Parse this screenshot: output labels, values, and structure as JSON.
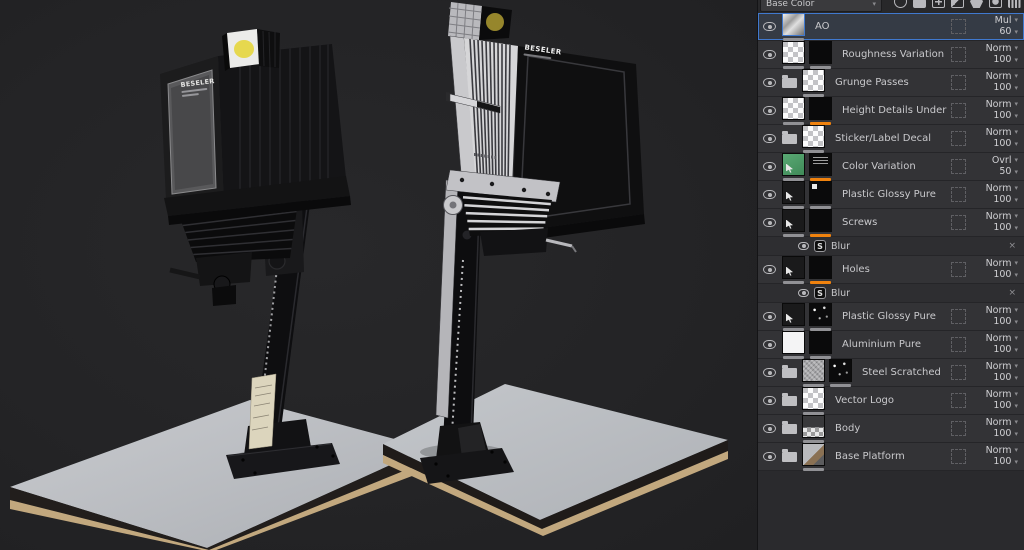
{
  "viewport": {
    "models": [
      {
        "name": "enlarger-left",
        "brand_label": "BESELER"
      },
      {
        "name": "enlarger-right",
        "brand_label": "BESELER"
      }
    ]
  },
  "layers_panel": {
    "channel_selector": {
      "value": "Base Color"
    },
    "glyphs": {
      "caret": "▾",
      "close": "×",
      "substance_effect": "S"
    },
    "colors": {
      "accent_orange": "#ef820e",
      "selection_blue": "#4079cf",
      "underline_gray": "#919195"
    },
    "toolbar": {
      "icons": [
        {
          "name": "add-effect-icon"
        },
        {
          "name": "add-folder-icon"
        },
        {
          "name": "add-layer-icon"
        },
        {
          "name": "add-fill-layer-icon"
        },
        {
          "name": "add-smart-material-icon"
        },
        {
          "name": "add-mask-icon"
        },
        {
          "name": "delete-layer-icon"
        }
      ]
    },
    "layers": [
      {
        "name": "AO",
        "blend": "Mul",
        "opacity": "60",
        "selected": true,
        "folder": false,
        "thumbs": [
          {
            "type": "ao",
            "underline": "gray"
          }
        ],
        "effects": []
      },
      {
        "name": "Roughness Variation",
        "blend": "Norm",
        "opacity": "100",
        "selected": false,
        "folder": false,
        "thumbs": [
          {
            "type": "checker",
            "underline": "gray"
          },
          {
            "type": "black",
            "underline": "gray"
          }
        ],
        "effects": []
      },
      {
        "name": "Grunge Passes",
        "blend": "Norm",
        "opacity": "100",
        "selected": false,
        "folder": true,
        "thumbs": [
          {
            "type": "checker",
            "underline": "gray"
          }
        ],
        "effects": []
      },
      {
        "name": "Height Details Under",
        "blend": "Norm",
        "opacity": "100",
        "selected": false,
        "folder": false,
        "thumbs": [
          {
            "type": "checker",
            "underline": "gray"
          },
          {
            "type": "black",
            "underline": "orange"
          }
        ],
        "effects": []
      },
      {
        "name": "Sticker/Label Decal",
        "blend": "Norm",
        "opacity": "100",
        "selected": false,
        "folder": true,
        "thumbs": [
          {
            "type": "checker",
            "underline": "gray"
          }
        ],
        "effects": []
      },
      {
        "name": "Color Variation",
        "blend": "Ovrl",
        "opacity": "50",
        "selected": false,
        "folder": false,
        "thumbs": [
          {
            "type": "green-cursor",
            "underline": "gray"
          },
          {
            "type": "black-text",
            "underline": "orange"
          }
        ],
        "effects": []
      },
      {
        "name": "Plastic Glossy Pure",
        "blend": "Norm",
        "opacity": "100",
        "selected": false,
        "folder": false,
        "thumbs": [
          {
            "type": "dark-cursor",
            "underline": "gray"
          },
          {
            "type": "black-dot",
            "underline": "gray"
          }
        ],
        "effects": []
      },
      {
        "name": "Screws",
        "blend": "Norm",
        "opacity": "100",
        "selected": false,
        "folder": false,
        "thumbs": [
          {
            "type": "dark-cursor",
            "underline": "gray"
          },
          {
            "type": "black",
            "underline": "orange"
          }
        ],
        "effects": [
          {
            "label": "Blur"
          }
        ]
      },
      {
        "name": "Holes",
        "blend": "Norm",
        "opacity": "100",
        "selected": false,
        "folder": false,
        "thumbs": [
          {
            "type": "dark-cursor",
            "underline": "gray"
          },
          {
            "type": "black",
            "underline": "orange"
          }
        ],
        "effects": [
          {
            "label": "Blur"
          }
        ]
      },
      {
        "name": "Plastic Glossy Pure",
        "blend": "Norm",
        "opacity": "100",
        "selected": false,
        "folder": false,
        "thumbs": [
          {
            "type": "dark-cursor",
            "underline": "gray"
          },
          {
            "type": "black-specks",
            "underline": "gray"
          }
        ],
        "effects": []
      },
      {
        "name": "Aluminium Pure",
        "blend": "Norm",
        "opacity": "100",
        "selected": false,
        "folder": false,
        "thumbs": [
          {
            "type": "white",
            "underline": "gray"
          },
          {
            "type": "black",
            "underline": "gray"
          }
        ],
        "effects": []
      },
      {
        "name": "Steel Scratched",
        "blend": "Norm",
        "opacity": "100",
        "selected": false,
        "folder": true,
        "thumbs": [
          {
            "type": "gray-noise",
            "underline": "gray"
          },
          {
            "type": "black-specks",
            "underline": "gray"
          }
        ],
        "effects": []
      },
      {
        "name": "Vector Logo",
        "blend": "Norm",
        "opacity": "100",
        "selected": false,
        "folder": true,
        "thumbs": [
          {
            "type": "checker",
            "underline": "gray"
          }
        ],
        "effects": []
      },
      {
        "name": "Body",
        "blend": "Norm",
        "opacity": "100",
        "selected": false,
        "folder": true,
        "thumbs": [
          {
            "type": "photo-body",
            "underline": "gray"
          }
        ],
        "effects": []
      },
      {
        "name": "Base Platform",
        "blend": "Norm",
        "opacity": "100",
        "selected": false,
        "folder": true,
        "thumbs": [
          {
            "type": "photo-base",
            "underline": "gray"
          }
        ],
        "effects": []
      }
    ]
  }
}
